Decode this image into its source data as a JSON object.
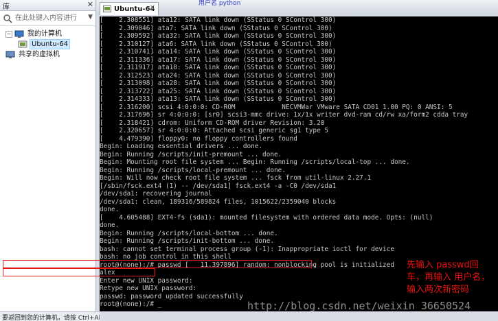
{
  "library": {
    "title": "库",
    "close_glyph": "✕",
    "search_placeholder": "在此处键入内容进行...",
    "search_dropdown_glyph": "▼",
    "toggle_glyph": "−",
    "tree": [
      {
        "label": "我的计算机",
        "level": 0
      },
      {
        "label": "Ubuntu-64",
        "level": 1
      },
      {
        "label": "共享的虚拟机",
        "level": 0
      }
    ],
    "status_text": "要返回到您的计算机，请按 Ctrl+Alt。"
  },
  "vm": {
    "tab_label": "Ubuntu-64",
    "tab_close_glyph": "✕",
    "watermark_user": "用户名 python"
  },
  "console_lines": [
    "[    2.308551] ata12: SATA link down (SStatus 0 SControl 300)",
    "[    2.309046] ata7: SATA link down (SStatus 0 SControl 300)",
    "[    2.309592] ata32: SATA link down (SStatus 0 SControl 300)",
    "[    2.310127] ata6: SATA link down (SStatus 0 SControl 300)",
    "[    2.310741] ata14: SATA link down (SStatus 0 SControl 300)",
    "[    2.311336] ata17: SATA link down (SStatus 0 SControl 300)",
    "[    2.311917] ata18: SATA link down (SStatus 0 SControl 300)",
    "[    2.312523] ata24: SATA link down (SStatus 0 SControl 300)",
    "[    2.313098] ata28: SATA link down (SStatus 0 SControl 300)",
    "[    2.313722] ata25: SATA link down (SStatus 0 SControl 300)",
    "[    2.314333] ata13: SATA link down (SStatus 0 SControl 300)",
    "[    2.316200] scsi 4:0:0:0: CD-ROM            NECVMWar VMware SATA CD01 1.00 PQ: 0 ANSI: 5",
    "[    2.317696] sr 4:0:0:0: [sr0] scsi3-mmc drive: 1x/1x writer dvd-ram cd/rw xa/form2 cdda tray",
    "[    2.318421] cdrom: Uniform CD-ROM driver Revision: 3.20",
    "[    2.320657] sr 4:0:0:0: Attached scsi generic sg1 type 5",
    "[    4.479390] floppy0: no floppy controllers found",
    "Begin: Loading essential drivers ... done.",
    "Begin: Running /scripts/init-premount ... done.",
    "Begin: Mounting root file system ... Begin: Running /scripts/local-top ... done.",
    "Begin: Running /scripts/local-premount ... done.",
    "Begin: Will now check root file system ... fsck from util-linux 2.27.1",
    "[/sbin/fsck.ext4 (1) -- /dev/sda1] fsck.ext4 -a -C0 /dev/sda1",
    "/dev/sda1: recovering journal",
    "/dev/sda1: clean, 189316/589824 files, 1015622/2359040 blocks",
    "done.",
    "[    4.605488] EXT4-fs (sda1): mounted filesystem with ordered data mode. Opts: (null)",
    "done.",
    "Begin: Running /scripts/local-bottom ... done.",
    "Begin: Running /scripts/init-bottom ... done.",
    "bash: cannot set terminal process group (-1): Inappropriate ioctl for device",
    "bash: no job control in this shell",
    "root@(none):/# passwd [   11.397896] random: nonblocking pool is initialized",
    "alex",
    "Enter new UNIX password:",
    "Retype new UNIX password:",
    "passwd: password updated successfully",
    "root@(none):/# _"
  ],
  "annotation": "先输入 passwd回车，再输入 用户名，输入两次新密码",
  "watermark": "http://blog.csdn.net/weixin_36650524"
}
